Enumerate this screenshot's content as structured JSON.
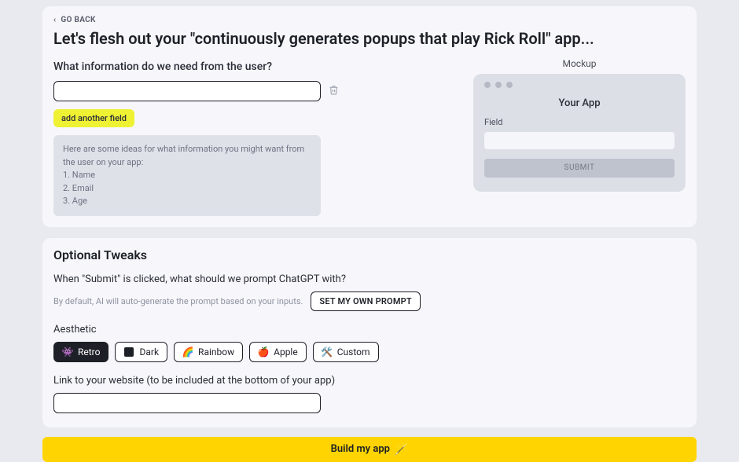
{
  "nav": {
    "back_label": "GO BACK"
  },
  "title": "Let's flesh out your \"continuously generates popups that play Rick Roll\" app...",
  "user_info": {
    "question": "What information do we need from the user?",
    "field_value": "",
    "add_field_label": "add another field",
    "hint_intro": "Here are some ideas for what information you might want from the user on your app:",
    "hint_items": [
      "1. Name",
      "2. Email",
      "3. Age"
    ]
  },
  "mockup": {
    "heading": "Mockup",
    "app_title": "Your App",
    "field_label": "Field",
    "submit_label": "SUBMIT"
  },
  "tweaks": {
    "heading": "Optional Tweaks",
    "prompt_question": "When \"Submit\" is clicked, what should we prompt ChatGPT with?",
    "helper_text": "By default, AI will auto-generate the prompt based on your inputs.",
    "set_prompt_label": "SET MY OWN PROMPT",
    "aesthetic_label": "Aesthetic",
    "aesthetic_options": {
      "retro": "Retro",
      "dark": "Dark",
      "rainbow": "Rainbow",
      "apple": "Apple",
      "custom": "Custom"
    },
    "selected_aesthetic": "retro",
    "link_label": "Link to your website (to be included at the bottom of your app)",
    "link_value": ""
  },
  "build_label": "Build my app",
  "icons": {
    "retro": "👾",
    "rainbow": "🌈",
    "apple": "🍎",
    "custom": "🛠️",
    "sparkle": "🪄"
  }
}
